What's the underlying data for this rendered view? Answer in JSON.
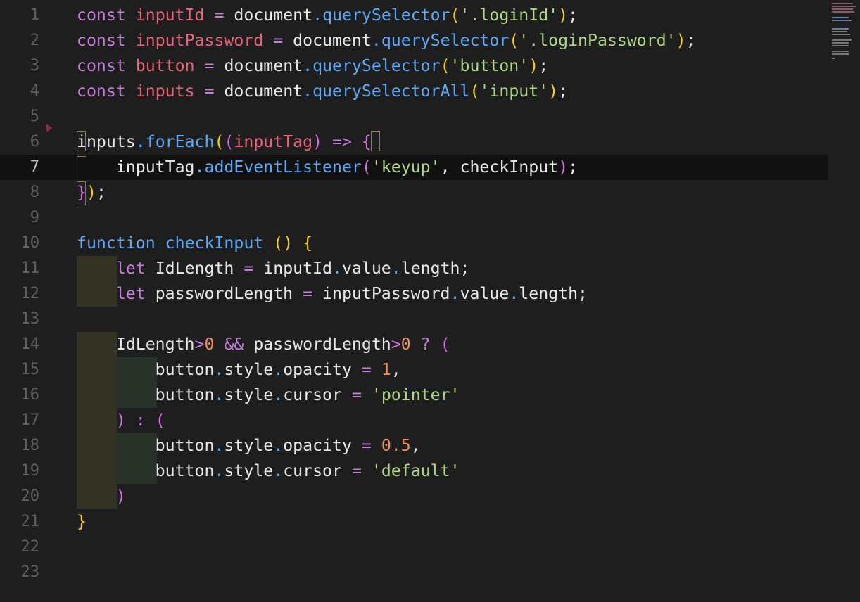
{
  "editor": {
    "current_line": 7,
    "lines": [
      {
        "n": "1",
        "tokens": [
          {
            "t": "const",
            "c": "kw"
          },
          {
            "t": " "
          },
          {
            "t": "inputId",
            "c": "var"
          },
          {
            "t": " "
          },
          {
            "t": "=",
            "c": "op"
          },
          {
            "t": " document"
          },
          {
            "t": ".",
            "c": "dot"
          },
          {
            "t": "querySelector",
            "c": "fn"
          },
          {
            "t": "(",
            "c": "b1"
          },
          {
            "t": "'.loginId'",
            "c": "str"
          },
          {
            "t": ")",
            "c": "b1"
          },
          {
            "t": ";"
          }
        ]
      },
      {
        "n": "2",
        "tokens": [
          {
            "t": "const",
            "c": "kw"
          },
          {
            "t": " "
          },
          {
            "t": "inputPassword",
            "c": "var"
          },
          {
            "t": " "
          },
          {
            "t": "=",
            "c": "op"
          },
          {
            "t": " document"
          },
          {
            "t": ".",
            "c": "dot"
          },
          {
            "t": "querySelector",
            "c": "fn"
          },
          {
            "t": "(",
            "c": "b1"
          },
          {
            "t": "'.loginPassword'",
            "c": "str"
          },
          {
            "t": ")",
            "c": "b1"
          },
          {
            "t": ";"
          }
        ]
      },
      {
        "n": "3",
        "tokens": [
          {
            "t": "const",
            "c": "kw"
          },
          {
            "t": " "
          },
          {
            "t": "button",
            "c": "var"
          },
          {
            "t": " "
          },
          {
            "t": "=",
            "c": "op"
          },
          {
            "t": " document"
          },
          {
            "t": ".",
            "c": "dot"
          },
          {
            "t": "querySelector",
            "c": "fn"
          },
          {
            "t": "(",
            "c": "b1"
          },
          {
            "t": "'button'",
            "c": "str"
          },
          {
            "t": ")",
            "c": "b1"
          },
          {
            "t": ";"
          }
        ]
      },
      {
        "n": "4",
        "tokens": [
          {
            "t": "const",
            "c": "kw"
          },
          {
            "t": " "
          },
          {
            "t": "inputs",
            "c": "var"
          },
          {
            "t": " "
          },
          {
            "t": "=",
            "c": "op"
          },
          {
            "t": " document"
          },
          {
            "t": ".",
            "c": "dot"
          },
          {
            "t": "querySelectorAll",
            "c": "fn"
          },
          {
            "t": "(",
            "c": "b1"
          },
          {
            "t": "'input'",
            "c": "str"
          },
          {
            "t": ")",
            "c": "b1"
          },
          {
            "t": ";"
          }
        ]
      },
      {
        "n": "5",
        "tokens": []
      },
      {
        "n": "6",
        "tokens": [
          {
            "t": "inputs"
          },
          {
            "t": ".",
            "c": "dot"
          },
          {
            "t": "forEach",
            "c": "fn"
          },
          {
            "t": "(",
            "c": "b1"
          },
          {
            "t": "(",
            "c": "b2"
          },
          {
            "t": "inputTag",
            "c": "var"
          },
          {
            "t": ")",
            "c": "b2"
          },
          {
            "t": " "
          },
          {
            "t": "=>",
            "c": "op"
          },
          {
            "t": " "
          },
          {
            "t": "{",
            "c": "b2"
          }
        ]
      },
      {
        "n": "7",
        "tokens": [
          {
            "t": "    inputTag"
          },
          {
            "t": ".",
            "c": "dot"
          },
          {
            "t": "addEventListener",
            "c": "fn"
          },
          {
            "t": "(",
            "c": "b2"
          },
          {
            "t": "'keyup'",
            "c": "str"
          },
          {
            "t": ", checkInput"
          },
          {
            "t": ")",
            "c": "b2"
          },
          {
            "t": ";"
          }
        ]
      },
      {
        "n": "8",
        "tokens": [
          {
            "t": "}",
            "c": "b2"
          },
          {
            "t": ")",
            "c": "b1"
          },
          {
            "t": ";"
          }
        ]
      },
      {
        "n": "9",
        "tokens": []
      },
      {
        "n": "10",
        "tokens": [
          {
            "t": "function",
            "c": "kwb"
          },
          {
            "t": " "
          },
          {
            "t": "checkInput",
            "c": "fn"
          },
          {
            "t": " "
          },
          {
            "t": "()",
            "c": "b1"
          },
          {
            "t": " "
          },
          {
            "t": "{",
            "c": "b1"
          }
        ]
      },
      {
        "n": "11",
        "tokens": [
          {
            "t": "    "
          },
          {
            "t": "let",
            "c": "kw"
          },
          {
            "t": " IdLength "
          },
          {
            "t": "=",
            "c": "op"
          },
          {
            "t": " inputId"
          },
          {
            "t": ".",
            "c": "dot"
          },
          {
            "t": "value"
          },
          {
            "t": ".",
            "c": "dot"
          },
          {
            "t": "length"
          },
          {
            "t": ";"
          }
        ]
      },
      {
        "n": "12",
        "tokens": [
          {
            "t": "    "
          },
          {
            "t": "let",
            "c": "kw"
          },
          {
            "t": " passwordLength "
          },
          {
            "t": "=",
            "c": "op"
          },
          {
            "t": " inputPassword"
          },
          {
            "t": ".",
            "c": "dot"
          },
          {
            "t": "value"
          },
          {
            "t": ".",
            "c": "dot"
          },
          {
            "t": "length"
          },
          {
            "t": ";"
          }
        ]
      },
      {
        "n": "13",
        "tokens": []
      },
      {
        "n": "14",
        "tokens": [
          {
            "t": "    IdLength"
          },
          {
            "t": ">",
            "c": "op"
          },
          {
            "t": "0",
            "c": "num"
          },
          {
            "t": " "
          },
          {
            "t": "&&",
            "c": "op"
          },
          {
            "t": " passwordLength"
          },
          {
            "t": ">",
            "c": "op"
          },
          {
            "t": "0",
            "c": "num"
          },
          {
            "t": " "
          },
          {
            "t": "?",
            "c": "op"
          },
          {
            "t": " "
          },
          {
            "t": "(",
            "c": "b2"
          }
        ]
      },
      {
        "n": "15",
        "tokens": [
          {
            "t": "        button"
          },
          {
            "t": ".",
            "c": "dot"
          },
          {
            "t": "style"
          },
          {
            "t": ".",
            "c": "dot"
          },
          {
            "t": "opacity "
          },
          {
            "t": "=",
            "c": "op"
          },
          {
            "t": " "
          },
          {
            "t": "1",
            "c": "num"
          },
          {
            "t": ","
          }
        ]
      },
      {
        "n": "16",
        "tokens": [
          {
            "t": "        button"
          },
          {
            "t": ".",
            "c": "dot"
          },
          {
            "t": "style"
          },
          {
            "t": ".",
            "c": "dot"
          },
          {
            "t": "cursor "
          },
          {
            "t": "=",
            "c": "op"
          },
          {
            "t": " "
          },
          {
            "t": "'pointer'",
            "c": "str"
          }
        ]
      },
      {
        "n": "17",
        "tokens": [
          {
            "t": "    "
          },
          {
            "t": ")",
            "c": "b2"
          },
          {
            "t": " "
          },
          {
            "t": ":",
            "c": "op"
          },
          {
            "t": " "
          },
          {
            "t": "(",
            "c": "b2"
          }
        ]
      },
      {
        "n": "18",
        "tokens": [
          {
            "t": "        button"
          },
          {
            "t": ".",
            "c": "dot"
          },
          {
            "t": "style"
          },
          {
            "t": ".",
            "c": "dot"
          },
          {
            "t": "opacity "
          },
          {
            "t": "=",
            "c": "op"
          },
          {
            "t": " "
          },
          {
            "t": "0.5",
            "c": "num"
          },
          {
            "t": ","
          }
        ]
      },
      {
        "n": "19",
        "tokens": [
          {
            "t": "        button"
          },
          {
            "t": ".",
            "c": "dot"
          },
          {
            "t": "style"
          },
          {
            "t": ".",
            "c": "dot"
          },
          {
            "t": "cursor "
          },
          {
            "t": "=",
            "c": "op"
          },
          {
            "t": " "
          },
          {
            "t": "'default'",
            "c": "str"
          }
        ]
      },
      {
        "n": "20",
        "tokens": [
          {
            "t": "    "
          },
          {
            "t": ")",
            "c": "b2"
          }
        ]
      },
      {
        "n": "21",
        "tokens": [
          {
            "t": "}",
            "c": "b1"
          }
        ]
      },
      {
        "n": "22",
        "tokens": []
      },
      {
        "n": "23",
        "tokens": []
      }
    ]
  },
  "colors": {
    "background": "#1e1e1e",
    "current_line": "#111111",
    "keyword": "#c77dda",
    "variable": "#e8647b",
    "function": "#5fa8f5",
    "string": "#aed58a",
    "number": "#ef8c64",
    "bracket_yellow": "#f5d020",
    "bracket_purple": "#d46ee0",
    "text": "#e8e8e8"
  }
}
